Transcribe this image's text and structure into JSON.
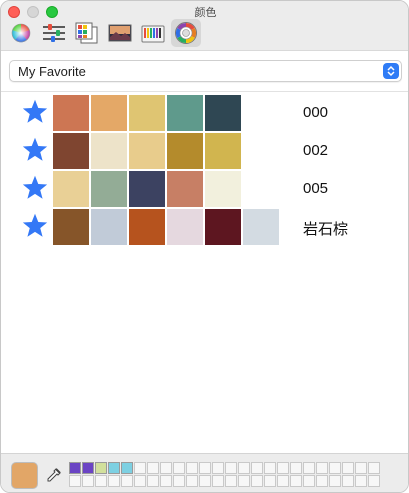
{
  "window": {
    "title": "颜色"
  },
  "toolbar": {
    "tabs": [
      {
        "name": "color-wheel-icon",
        "active": false
      },
      {
        "name": "color-sliders-icon",
        "active": false
      },
      {
        "name": "color-palettes-icon",
        "active": false
      },
      {
        "name": "image-palettes-icon",
        "active": false
      },
      {
        "name": "pencils-icon",
        "active": false
      },
      {
        "name": "palette-wheel-icon",
        "active": true
      }
    ]
  },
  "palette_selector": {
    "selected": "My Favorite"
  },
  "palettes": [
    {
      "name": "000",
      "colors": [
        "#cd7653",
        "#e4a867",
        "#dfc572",
        "#5f9a8c",
        "#2f4753"
      ]
    },
    {
      "name": "002",
      "colors": [
        "#7f4530",
        "#ede3c9",
        "#e8cc8c",
        "#b48b2c",
        "#d1b54f"
      ]
    },
    {
      "name": "005",
      "colors": [
        "#e9d096",
        "#93ac96",
        "#3c4261",
        "#c77f65",
        "#f2f0dd"
      ]
    },
    {
      "name": "岩石棕",
      "colors": [
        "#865529",
        "#c1cbd8",
        "#b6531e",
        "#e5d8df",
        "#5d1620",
        "#d3dbe2"
      ]
    }
  ],
  "bottom": {
    "current_color": "#e2a667",
    "saved_swatches": [
      "#6a44c4",
      "#6b44c4",
      "#d2e09c",
      "#7dd0e2",
      "#7dd0e2"
    ]
  },
  "accent": "#2f7cf6",
  "star_color": "#3478f6"
}
